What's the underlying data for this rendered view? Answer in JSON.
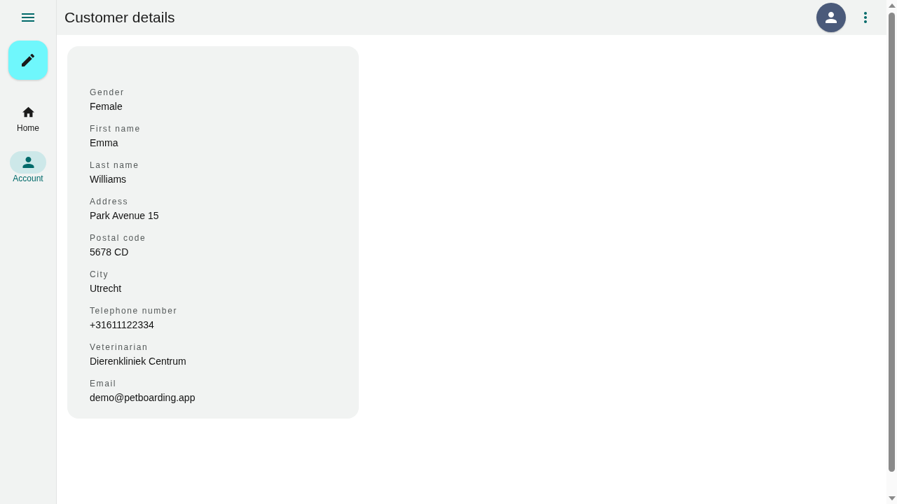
{
  "navigation_rail": {
    "items": [
      {
        "kind": "home",
        "label": "Home",
        "selected": false
      },
      {
        "kind": "account",
        "label": "Account",
        "selected": true
      }
    ]
  },
  "top_bar": {
    "title": "Customer details"
  },
  "customer_card": {
    "fields": [
      {
        "label": "Gender",
        "value": "Female"
      },
      {
        "label": "First name",
        "value": "Emma"
      },
      {
        "label": "Last name",
        "value": "Williams"
      },
      {
        "label": "Address",
        "value": "Park Avenue 15"
      },
      {
        "label": "Postal code",
        "value": "5678 CD"
      },
      {
        "label": "City",
        "value": "Utrecht"
      },
      {
        "label": "Telephone number",
        "value": "+31611122334"
      },
      {
        "label": "Veterinarian",
        "value": "Dierenkliniek Centrum"
      },
      {
        "label": "Email",
        "value": "demo@petboarding.app"
      }
    ]
  }
}
